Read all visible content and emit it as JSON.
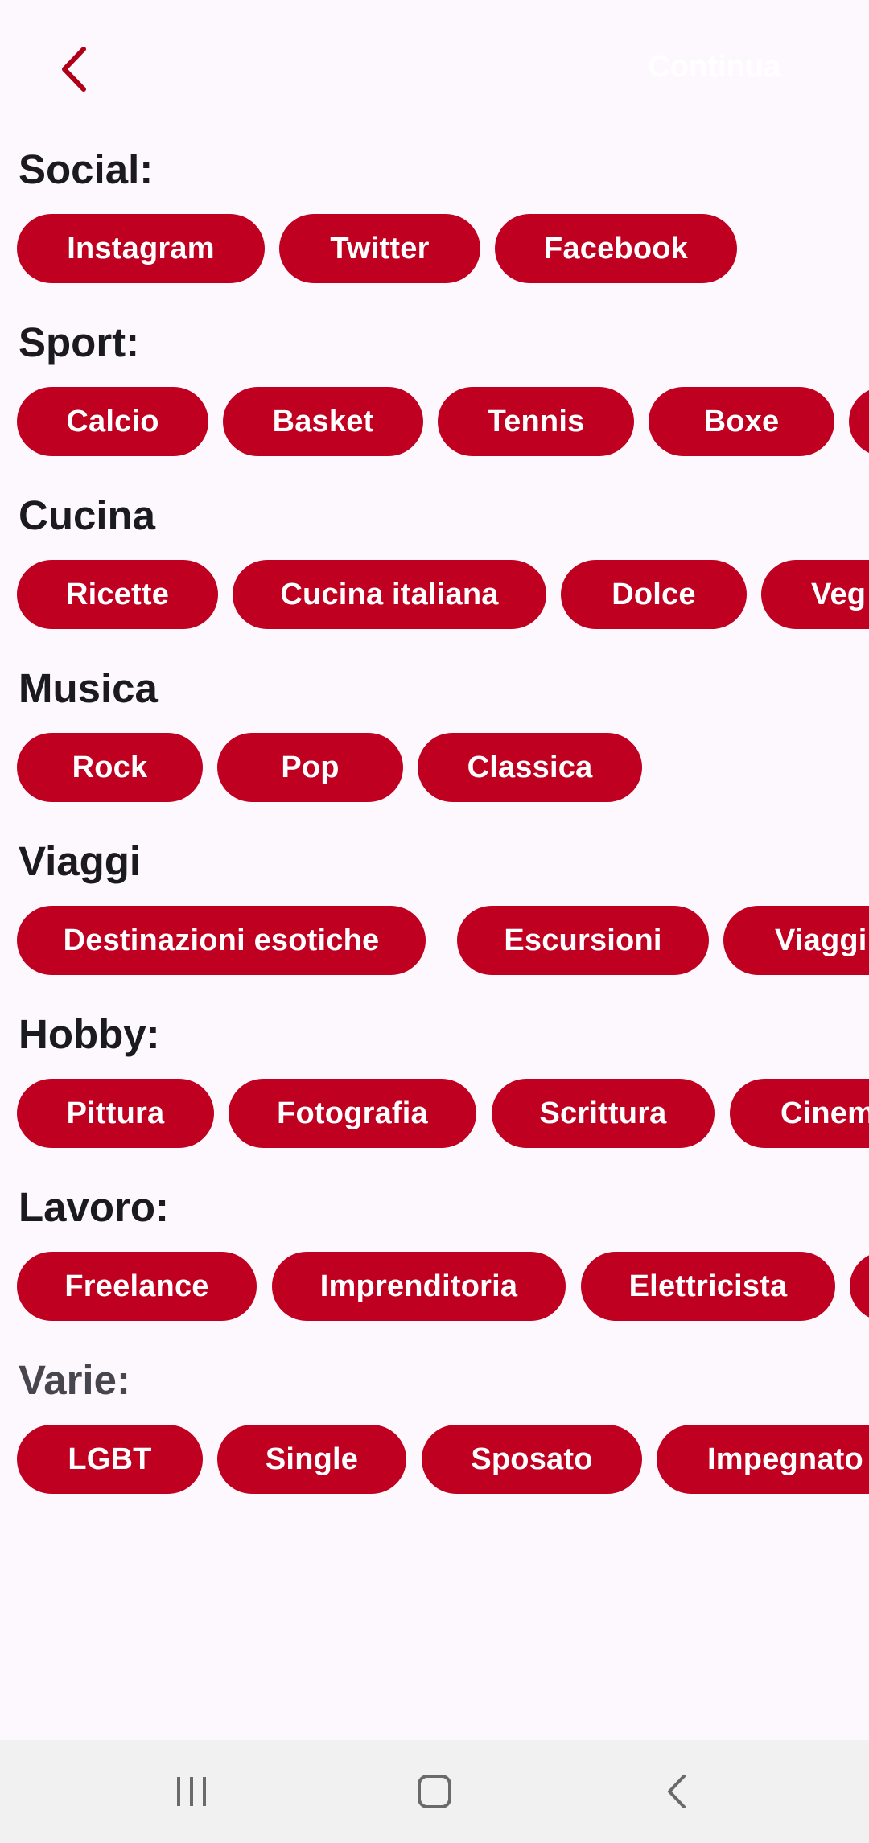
{
  "header": {
    "back_icon": "chevron-left-icon",
    "action_label": "Continua",
    "accent": "#c00020"
  },
  "sections": {
    "social": {
      "title": "Social:",
      "chips": [
        "Instagram",
        "Twitter",
        "Facebook"
      ]
    },
    "sport": {
      "title": "Sport:",
      "chips": [
        "Calcio",
        "Basket",
        "Tennis",
        "Boxe",
        ""
      ]
    },
    "cucina": {
      "title": "Cucina",
      "chips": [
        "Ricette",
        "Cucina italiana",
        "Dolce",
        "Veg"
      ]
    },
    "musica": {
      "title": "Musica",
      "chips": [
        "Rock",
        "Pop",
        "Classica"
      ]
    },
    "viaggi": {
      "title": "Viaggi",
      "chips": [
        "Destinazioni esotiche",
        "Escursioni",
        "Viaggi"
      ]
    },
    "hobby": {
      "title": "Hobby:",
      "chips": [
        "Pittura",
        "Fotografia",
        "Scrittura",
        "Cinem"
      ]
    },
    "lavoro": {
      "title": "Lavoro:",
      "chips": [
        "Freelance",
        "Imprenditoria",
        "Elettricista",
        ""
      ]
    },
    "varie": {
      "title": "Varie:",
      "chips": [
        "LGBT",
        "Single",
        "Sposato",
        "Impegnato"
      ]
    }
  },
  "navbar": {
    "recents_icon": "recent-apps-icon",
    "home_icon": "home-icon",
    "back_icon": "nav-back-icon",
    "background": "#f1f1f1"
  }
}
